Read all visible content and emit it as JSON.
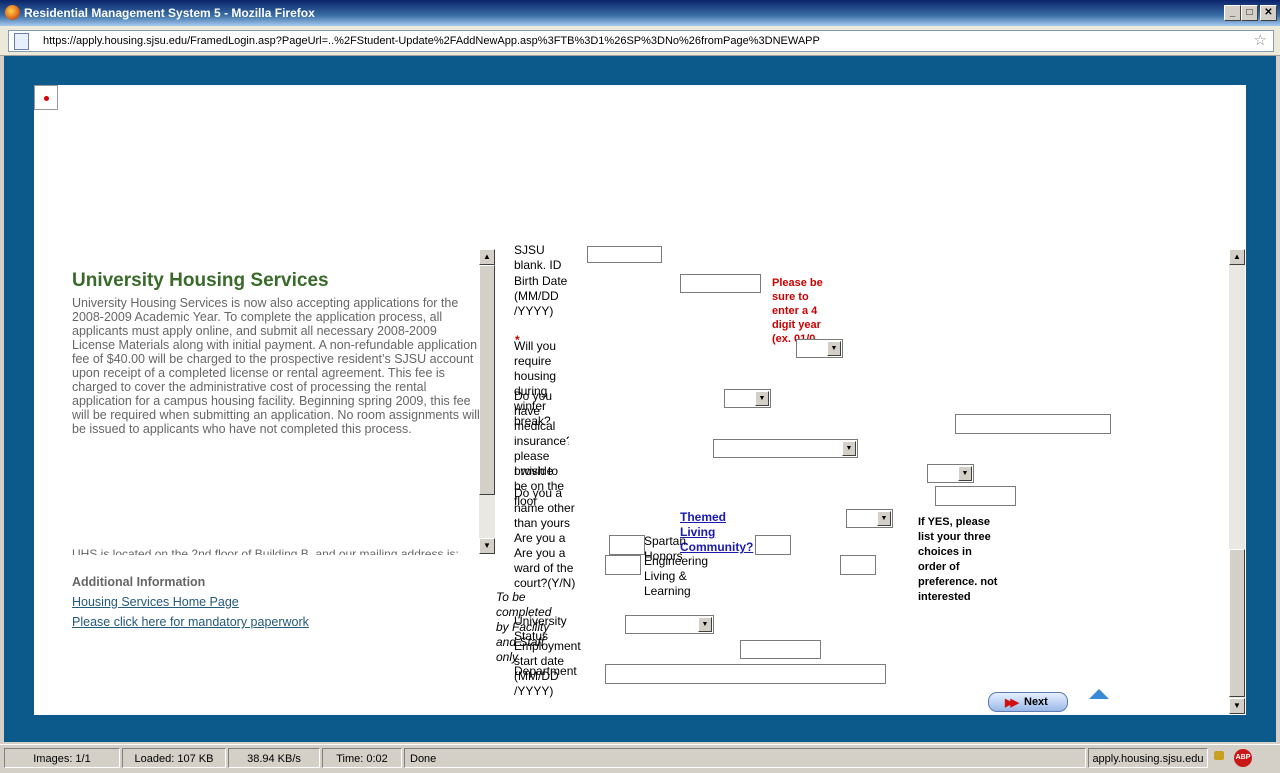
{
  "window": {
    "title": "Residential Management System 5 - Mozilla Firefox"
  },
  "browser": {
    "url": "https://apply.housing.sjsu.edu/FramedLogin.asp?PageUrl=..%2FStudent-Update%2FAddNewApp.asp%3FTB%3D1%26SP%3DNo%26fromPage%3DNEWAPP"
  },
  "left": {
    "heading": "University Housing Services",
    "body": "University Housing Services is now also accepting applications for the 2008-2009 Academic Year. To complete the application process, all applicants must apply online, and submit all necessary 2008-2009 License Materials along with initial payment. A non-refundable application fee of $40.00 will be charged to the prospective resident’s SJSU account upon receipt of a completed license or rental agreement. This fee is charged to cover the administrative cost of processing the rental application for a campus housing facility. Beginning spring 2009, this fee will be required when submitting an application. No room assignments will be issued to applicants who have not completed this process.",
    "clipped_line": "UHS is located on the 2nd floor of Building B, and our mailing address is:",
    "additional_info": "Additional Information",
    "links": [
      "Housing Services Home Page",
      "Please click here for mandatory paperwork"
    ]
  },
  "form": {
    "overlap_top": "SJSU blank. ID",
    "birth_label": "Birth Date (MM/DD /YYYY)",
    "birth_note": "Please be sure to enter a 4 digit year (ex. 01/0",
    "asterisk": "*",
    "winter_label": "Will you require housing during winter break?",
    "medical_label": "Do you have medical insurance? please provide your carrier",
    "wish_label": "I wish to be on the floor",
    "overlap_mid": "Do you a name other than yours Are you a dependent of the court?(Y/N)",
    "are_you_label": "Are you a ward of the court?(Y/N)",
    "spartan_label": "Spartan Honors",
    "engineering_label": "Engineering Living & Learning",
    "themed_link": "Themed Living Community?",
    "if_yes": "If YES, please list your three choices in order of preference. not interested",
    "to_be": "To be completed by Facility and Staff only",
    "university_status_label": "University Status",
    "employment_label": "Employment start date (MM/DD /YYYY)",
    "department_label": "Department",
    "next_label": "Next"
  },
  "status": {
    "images": "Images: 1/1",
    "loaded": "Loaded: 107 KB",
    "speed": "38.94 KB/s",
    "time": "Time: 0:02",
    "state": "Done",
    "domain": "apply.housing.sjsu.edu",
    "abp": "ABP"
  }
}
